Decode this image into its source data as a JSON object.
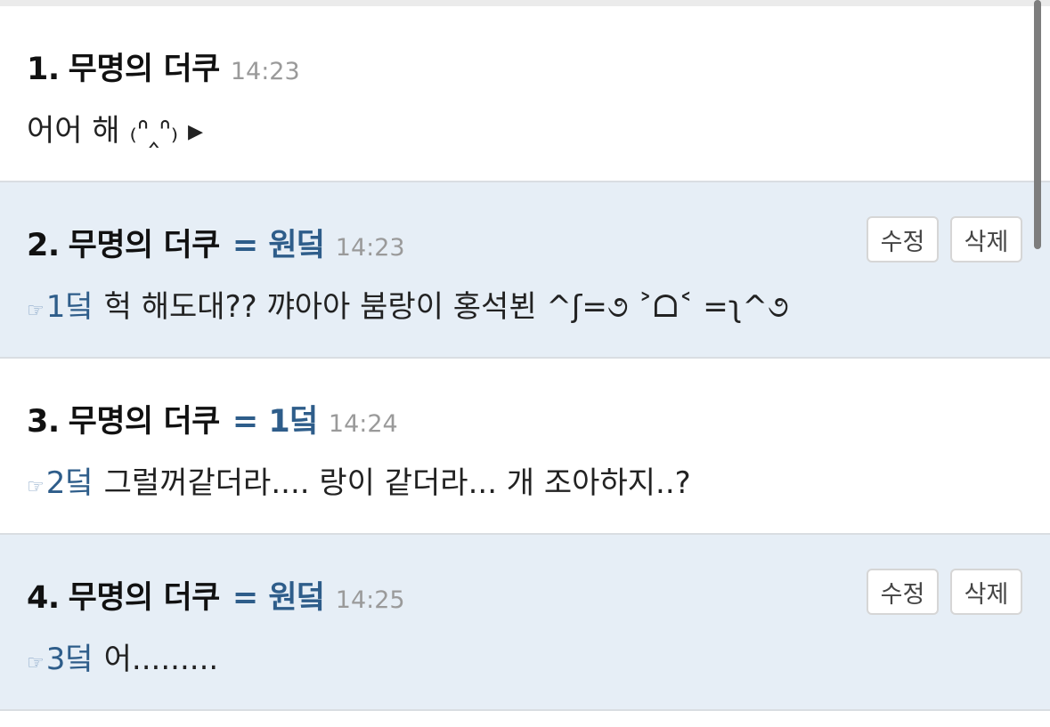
{
  "posts": [
    {
      "number": "1.",
      "author": "무명의 더쿠",
      "alias": "",
      "time": "14:23",
      "reply_ref": "",
      "content": "어어 해 ₍ᐢ‸ᐢ₎ ▸",
      "actions": []
    },
    {
      "number": "2.",
      "author": "무명의 더쿠",
      "alias": "= 원덬",
      "time": "14:23",
      "reply_ref": "1덬",
      "content": "헉 해도대?? 꺄아아 붐랑이 홍석뵌 ^ʃ=૭ ˃ᗝ˂ =ʅ^૭",
      "actions": [
        "수정",
        "삭제"
      ]
    },
    {
      "number": "3.",
      "author": "무명의 더쿠",
      "alias": "= 1덬",
      "time": "14:24",
      "reply_ref": "2덬",
      "content": "그럴꺼같더라.... 랑이 같더라... 개 조아하지..?",
      "actions": []
    },
    {
      "number": "4.",
      "author": "무명의 더쿠",
      "alias": "= 원덬",
      "time": "14:25",
      "reply_ref": "3덬",
      "content": "어.........",
      "actions": [
        "수정",
        "삭제"
      ]
    }
  ],
  "icons": {
    "reply_pointer": "pointing-hand-icon"
  },
  "colors": {
    "highlight_bg": "#e6eef6",
    "alias_text": "#2e5d8a",
    "time_text": "#9a9a9a"
  }
}
